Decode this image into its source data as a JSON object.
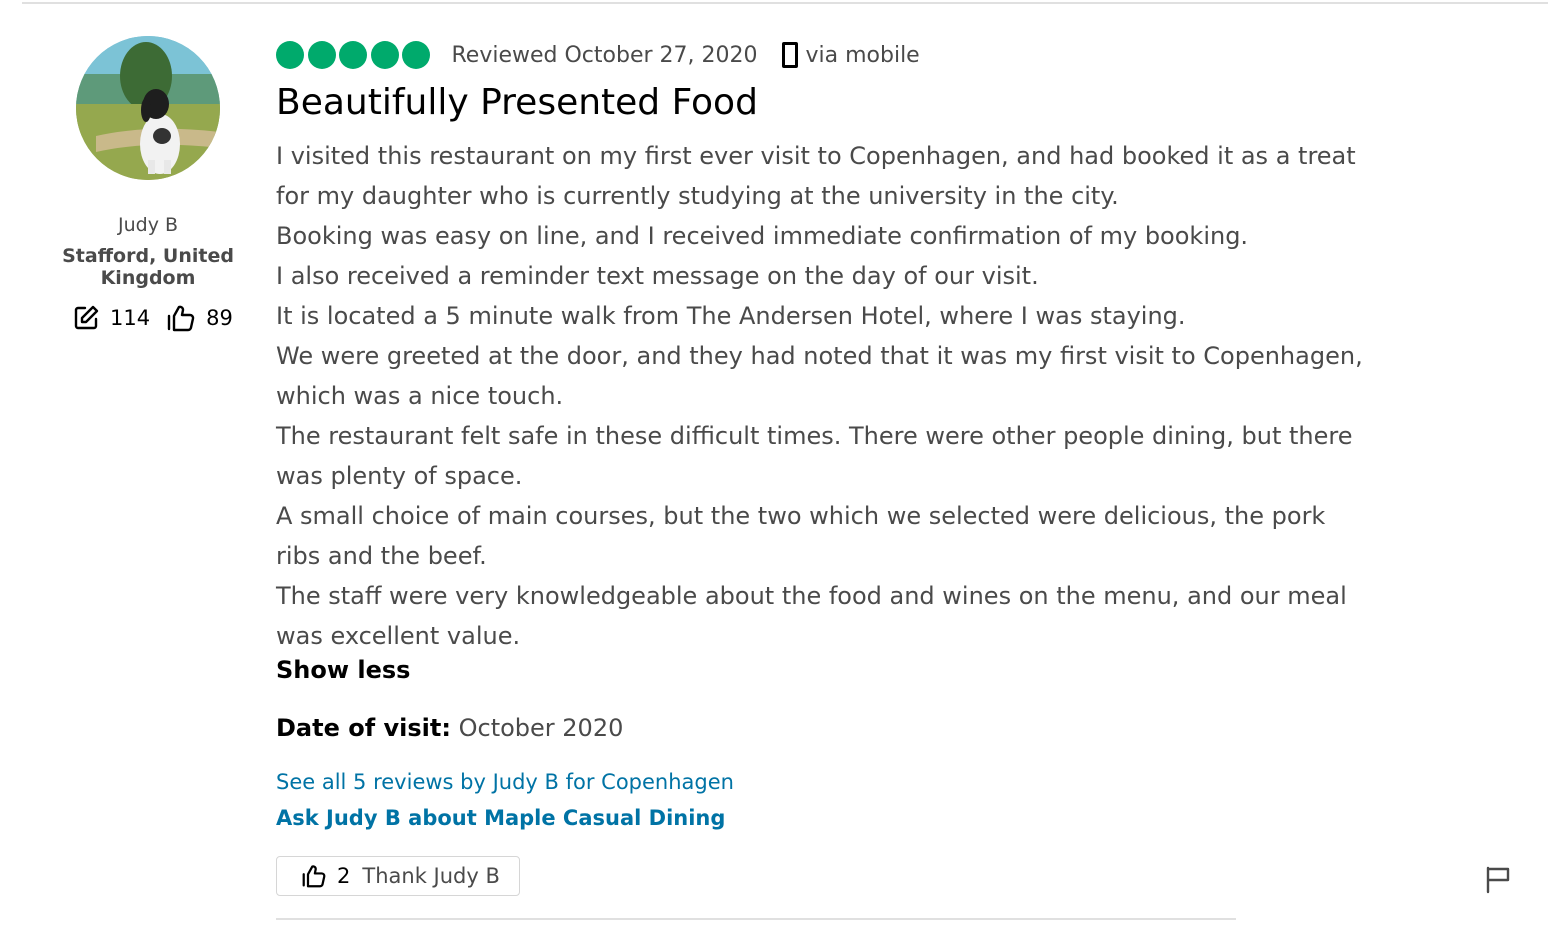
{
  "reviewer": {
    "name": "Judy B",
    "location": "Stafford, United Kingdom",
    "contributions": "114",
    "helpful_votes": "89",
    "avatar_icon": "dog-photo-avatar"
  },
  "review": {
    "rating_bubbles": 5,
    "rating_color": "#00aa6c",
    "reviewed_text": "Reviewed October 27, 2020",
    "via_text": "via mobile",
    "title": "Beautifully Presented Food",
    "lines": [
      "I visited this restaurant on my first ever visit to Copenhagen, and had booked it as a treat",
      "for my daughter who is currently studying at the university in the city.",
      "Booking was easy on line, and I received immediate confirmation of my booking.",
      "I also received a reminder text message on the day of our visit.",
      "It is located a 5 minute walk from The Andersen Hotel, where I was staying.",
      "We were greeted at the door, and they had noted that it was my first visit to Copenhagen,",
      "which was a nice touch.",
      "The restaurant felt safe in these difficult times. There were other people dining, but there",
      "was plenty of space.",
      "A small choice of main courses, but the two which we selected were delicious, the pork",
      "ribs and the beef.",
      "The staff were very knowledgeable about the food and wines on the menu, and our meal",
      "was excellent value."
    ],
    "show_less": "Show less",
    "date_of_visit_label": "Date of visit:",
    "date_of_visit_value": "October 2020"
  },
  "links": {
    "see_all": "See all 5 reviews by Judy B for Copenhagen",
    "ask": "Ask Judy B about Maple Casual Dining"
  },
  "thank_button": {
    "count": "2",
    "label": "Thank Judy B"
  },
  "colors": {
    "link": "#0073a5",
    "text_gray": "#4a4a4a"
  }
}
